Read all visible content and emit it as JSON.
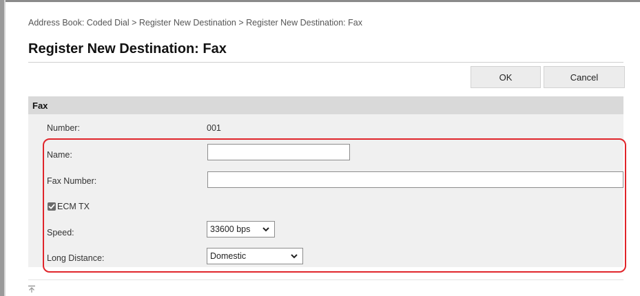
{
  "breadcrumb": "Address Book: Coded Dial > Register New Destination > Register New Destination: Fax",
  "page_title": "Register New Destination: Fax",
  "toolbar": {
    "ok_label": "OK",
    "cancel_label": "Cancel"
  },
  "section": {
    "title": "Fax",
    "number_label": "Number:",
    "number_value": "001",
    "name_label": "Name:",
    "name_value": "",
    "fax_number_label": "Fax Number:",
    "fax_number_value": "",
    "ecm_label": "ECM TX",
    "ecm_checked": true,
    "speed_label": "Speed:",
    "speed_value": "33600 bps",
    "long_distance_label": "Long Distance:",
    "long_distance_value": "Domestic"
  },
  "colors": {
    "highlight": "#e0242a",
    "section_header": "#d9d9d9",
    "section_bg": "#f0f0f0"
  },
  "icons": {
    "back_to_top": "back-to-top-icon",
    "chevron": "chevron-down-icon",
    "check": "check-icon"
  }
}
